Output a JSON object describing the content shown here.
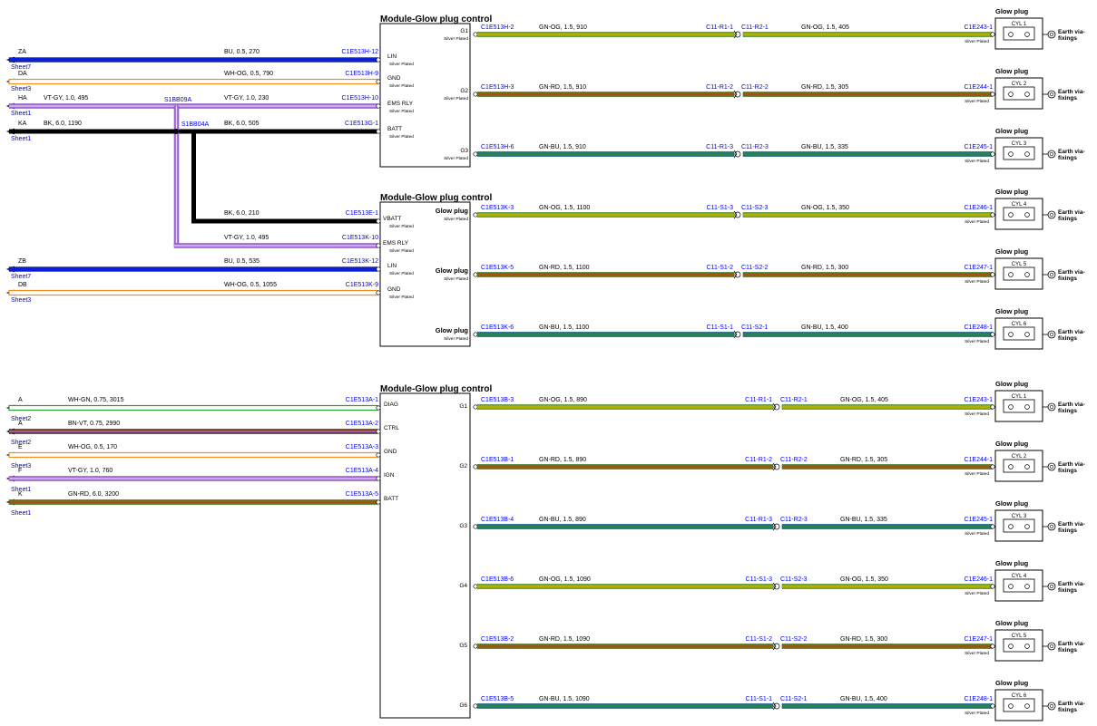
{
  "colors": {
    "BU": "#0a1fd6",
    "WH": "#ffffff",
    "OG": "#f28c1c",
    "VT": "#a56ad8",
    "GY": "#c8c8c8",
    "BK": "#000000",
    "GN": "#2e9a2e",
    "RD": "#d8261c",
    "YL": "#c4c400",
    "TL": "#2f8c8c",
    "link": "#0000ee",
    "bn": "#7b3b1a"
  },
  "common": {
    "module_title": "Module-Glow plug control",
    "glow_plug_title": "Glow plug",
    "silver_plated": "Silver Plated",
    "earth": [
      "Earth via-",
      "fixings"
    ]
  },
  "left_inputs": [
    {
      "id": "ZA",
      "sheet": "Sheet7",
      "spec": "BU, 0.5, 270",
      "conn": "C1E513H-12",
      "pin": "LIN",
      "color": "BU"
    },
    {
      "id": "DA",
      "sheet": "Sheet3",
      "spec": "WH-OG, 0.5, 790",
      "conn": "C1E513H-9",
      "pin": "GND",
      "color": "WH-OG"
    },
    {
      "id": "HA",
      "sheet": "Sheet1",
      "spec": "VT-GY, 1.0, 495",
      "conn": "C1E513H-10",
      "pin": "EMS RLY",
      "color": "VT-GY",
      "inner_spec": "VT-GY, 1.0, 230"
    },
    {
      "id": "KA",
      "sheet": "Sheet1",
      "spec": "BK, 6.0, 1190",
      "conn": "C1E513G-1",
      "pin": "BATT",
      "color": "BK",
      "inner_spec": "BK, 6.0, 505"
    },
    {
      "id": "ZB",
      "sheet": "Sheet7",
      "spec": "BU, 0.5, 535",
      "conn": "C1E513K-12",
      "pin": "LIN",
      "color": "BU"
    },
    {
      "id": "DB",
      "sheet": "Sheet3",
      "spec": "WH-OG, 0.5, 1055",
      "conn": "C1E513K-9",
      "pin": "GND",
      "color": "WH-OG"
    }
  ],
  "splices": [
    {
      "id": "S1BB09A"
    },
    {
      "id": "S1BB04A"
    }
  ],
  "module2_extra": [
    {
      "spec": "BK, 6.0, 210",
      "conn": "C1E513E-1",
      "pin": "VBATT"
    },
    {
      "spec": "VT-GY, 1.0, 495",
      "conn": "C1E513K-10",
      "pin": "EMS RLY"
    }
  ],
  "module1_outputs": [
    {
      "pin": "G1",
      "conn": "C1E513H-2",
      "spec": "GN-OG, 1.5, 910",
      "mid_l": "C11-R1-1",
      "mid_r": "C11-R2-1",
      "spec2": "GN-OG, 1.5, 405",
      "end": "C1E243-1",
      "cyl": "CYL 1",
      "color": "GN-OG"
    },
    {
      "pin": "G2",
      "conn": "C1E513H-3",
      "spec": "GN-RD, 1.5, 910",
      "mid_l": "C11-R1-2",
      "mid_r": "C11-R2-2",
      "spec2": "GN-RD, 1.5, 305",
      "end": "C1E244-1",
      "cyl": "CYL 2",
      "color": "GN-RD"
    },
    {
      "pin": "G3",
      "conn": "C1E513H-6",
      "spec": "GN-BU, 1.5, 910",
      "mid_l": "C11-R1-3",
      "mid_r": "C11-R2-3",
      "spec2": "GN-BU, 1.5, 335",
      "end": "C1E245-1",
      "cyl": "CYL 3",
      "color": "GN-BU"
    }
  ],
  "module2_outputs": [
    {
      "pin": "Glow plug",
      "conn": "C1E513K-3",
      "spec": "GN-OG, 1.5, 1100",
      "mid_l": "C11-S1-3",
      "mid_r": "C11-S2-3",
      "spec2": "GN-OG, 1.5, 350",
      "end": "C1E246-1",
      "cyl": "CYL 4",
      "color": "GN-OG"
    },
    {
      "pin": "Glow plug",
      "conn": "C1E513K-5",
      "spec": "GN-RD, 1.5, 1100",
      "mid_l": "C11-S1-2",
      "mid_r": "C11-S2-2",
      "spec2": "GN-RD, 1.5, 300",
      "end": "C1E247-1",
      "cyl": "CYL 5",
      "color": "GN-RD"
    },
    {
      "pin": "Glow plug",
      "conn": "C1E513K-6",
      "spec": "GN-BU, 1.5, 1100",
      "mid_l": "C11-S1-1",
      "mid_r": "C11-S2-1",
      "spec2": "GN-BU, 1.5, 400",
      "end": "C1E248-1",
      "cyl": "CYL 6",
      "color": "GN-BU"
    }
  ],
  "module3_inputs": [
    {
      "id": "A",
      "sheet": "Sheet2",
      "spec": "WH-GN, 0.75, 3015",
      "conn": "C1E513A-1",
      "pin": "DIAG",
      "color": "WH-GN"
    },
    {
      "id": "A",
      "sheet": "Sheet2",
      "spec": "BN-VT, 0.75, 2990",
      "conn": "C1E513A-2",
      "pin": "CTRL",
      "color": "BN-VT"
    },
    {
      "id": "E",
      "sheet": "Sheet3",
      "spec": "WH-OG, 0.5, 170",
      "conn": "C1E513A-3",
      "pin": "GND",
      "color": "WH-OG"
    },
    {
      "id": "F",
      "sheet": "Sheet1",
      "spec": "VT-GY, 1.0, 760",
      "conn": "C1E513A-4",
      "pin": "IGN",
      "color": "VT-GY"
    },
    {
      "id": "K",
      "sheet": "Sheet1",
      "spec": "GN-RD, 6.0, 3200",
      "conn": "C1E513A-5",
      "pin": "BATT",
      "color": "GN-RD"
    }
  ],
  "module3_outputs": [
    {
      "pin": "G1",
      "conn": "C1E513B-3",
      "spec": "GN-OG, 1.5, 890",
      "mid_l": "C11-R1-1",
      "mid_r": "C11-R2-1",
      "spec2": "GN-OG, 1.5, 405",
      "end": "C1E243-1",
      "cyl": "CYL 1",
      "color": "GN-OG"
    },
    {
      "pin": "G2",
      "conn": "C1E513B-1",
      "spec": "GN-RD, 1.5, 890",
      "mid_l": "C11-R1-2",
      "mid_r": "C11-R2-2",
      "spec2": "GN-RD, 1.5, 305",
      "end": "C1E244-1",
      "cyl": "CYL 2",
      "color": "GN-RD"
    },
    {
      "pin": "G3",
      "conn": "C1E513B-4",
      "spec": "GN-BU, 1.5, 890",
      "mid_l": "C11-R1-3",
      "mid_r": "C11-R2-3",
      "spec2": "GN-BU, 1.5, 335",
      "end": "C1E245-1",
      "cyl": "CYL 3",
      "color": "GN-BU"
    },
    {
      "pin": "G4",
      "conn": "C1E513B-6",
      "spec": "GN-OG, 1.5, 1090",
      "mid_l": "C11-S1-3",
      "mid_r": "C11-S2-3",
      "spec2": "GN-OG, 1.5, 350",
      "end": "C1E246-1",
      "cyl": "CYL 4",
      "color": "GN-OG"
    },
    {
      "pin": "G5",
      "conn": "C1E513B-2",
      "spec": "GN-RD, 1.5, 1090",
      "mid_l": "C11-S1-2",
      "mid_r": "C11-S2-2",
      "spec2": "GN-RD, 1.5, 300",
      "end": "C1E247-1",
      "cyl": "CYL 5",
      "color": "GN-RD"
    },
    {
      "pin": "G6",
      "conn": "C1E513B-5",
      "spec": "GN-BU, 1.5, 1090",
      "mid_l": "C11-S1-1",
      "mid_r": "C11-S2-1",
      "spec2": "GN-BU, 1.5, 400",
      "end": "C1E248-1",
      "cyl": "CYL 6",
      "color": "GN-BU"
    }
  ]
}
